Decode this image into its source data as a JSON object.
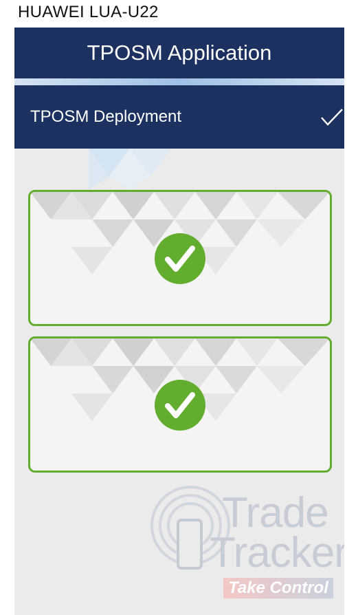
{
  "device": {
    "label": "HUAWEI LUA-U22"
  },
  "header": {
    "title": "TPOSM Application"
  },
  "section": {
    "title": "TPOSM Deployment",
    "action_icon": "checkmark-icon"
  },
  "cards": [
    {
      "icon": "check-circle-icon",
      "status": "completed"
    },
    {
      "icon": "check-circle-icon",
      "status": "completed"
    }
  ],
  "branding": {
    "line1": "Trade",
    "line2": "Tracker",
    "tagline": "Take Control"
  },
  "colors": {
    "primary": "#1d3160",
    "accent": "#63ad2e",
    "background": "#ebebeb"
  }
}
